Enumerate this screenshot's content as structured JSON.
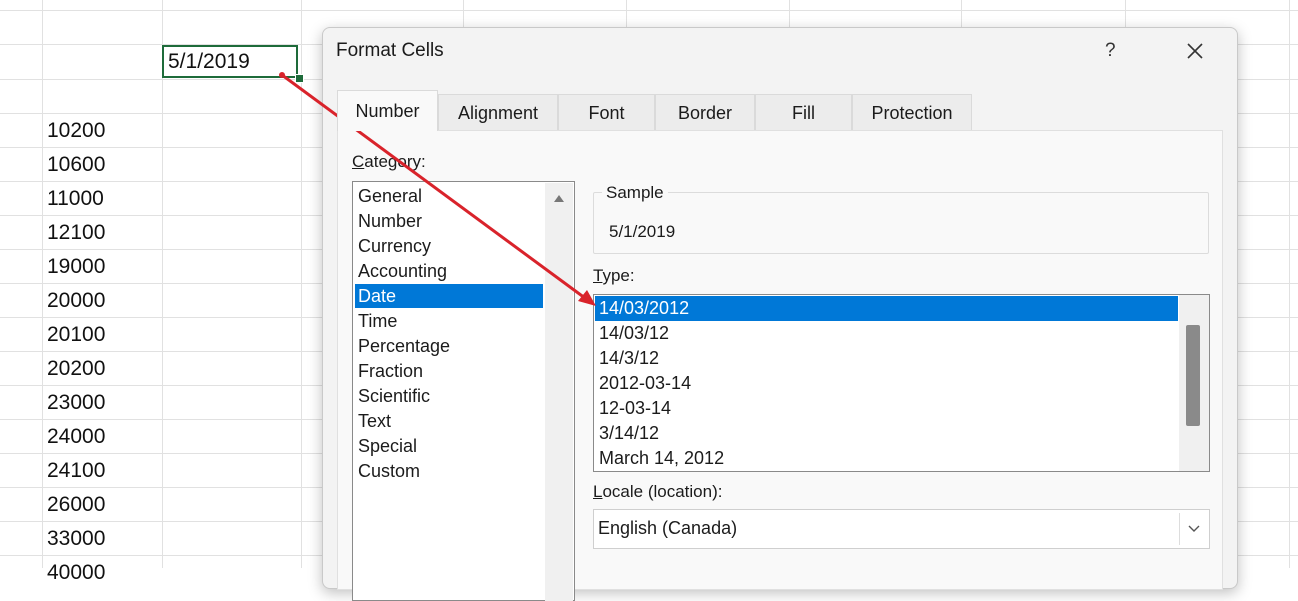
{
  "spreadsheet": {
    "active_cell_value": "5/1/2019",
    "column_values": [
      "10200",
      "10600",
      "11000",
      "12100",
      "19000",
      "20000",
      "20100",
      "20200",
      "23000",
      "24000",
      "24100",
      "26000",
      "33000",
      "40000"
    ]
  },
  "dialog": {
    "title": "Format Cells",
    "help_label": "?",
    "tabs": [
      "Number",
      "Alignment",
      "Font",
      "Border",
      "Fill",
      "Protection"
    ],
    "active_tab": "Number",
    "category_label_first": "C",
    "category_label_rest": "ategory:",
    "categories": [
      "General",
      "Number",
      "Currency",
      "Accounting",
      "Date",
      "Time",
      "Percentage",
      "Fraction",
      "Scientific",
      "Text",
      "Special",
      "Custom"
    ],
    "selected_category": "Date",
    "sample_title": "Sample",
    "sample_value": "5/1/2019",
    "type_label_first": "T",
    "type_label_rest": "ype:",
    "types": [
      "14/03/2012",
      "14/03/12",
      "14/3/12",
      "2012-03-14",
      "12-03-14",
      "3/14/12",
      "March 14, 2012"
    ],
    "selected_type": "14/03/2012",
    "locale_label_first": "L",
    "locale_label_rest": "ocale (location):",
    "locale_value": "English (Canada)"
  },
  "colors": {
    "selection": "#0078d7",
    "cell_border": "#1e6b3a",
    "annotation_arrow": "#d9232b"
  },
  "icons": {
    "close": "close-icon",
    "dropdown": "chevron-down-icon",
    "scroll_up": "scroll-up-icon"
  }
}
